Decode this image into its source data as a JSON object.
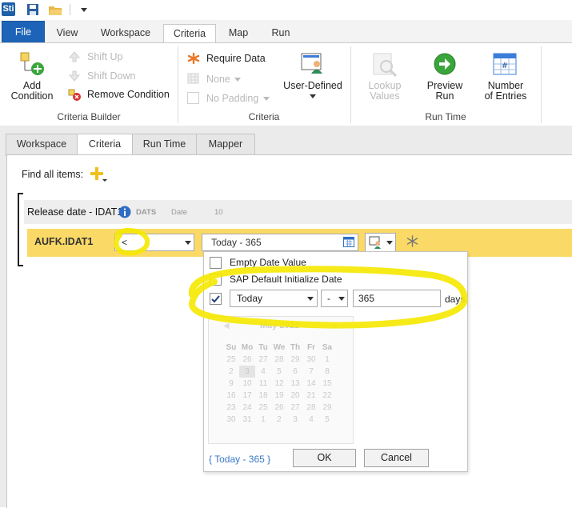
{
  "qat": {
    "logo": "Sti"
  },
  "ribbon_tabs": [
    {
      "label": "File"
    },
    {
      "label": "View"
    },
    {
      "label": "Workspace"
    },
    {
      "label": "Criteria"
    },
    {
      "label": "Map"
    },
    {
      "label": "Run"
    }
  ],
  "criteria_builder": {
    "add_condition": "Add\nCondition",
    "shift_up": "Shift Up",
    "shift_down": "Shift Down",
    "remove_condition": "Remove Condition",
    "group_label": "Criteria Builder"
  },
  "criteria_group": {
    "require_data": "Require Data",
    "none": "None",
    "no_padding": "No Padding",
    "user_defined": "User-Defined",
    "group_label": "Criteria"
  },
  "run_time_group": {
    "lookup_values": "Lookup\nValues",
    "preview_run": "Preview\nRun",
    "number_of_entries": "Number\nof Entries",
    "group_label": "Run Time"
  },
  "panel_tabs": [
    {
      "label": "Workspace"
    },
    {
      "label": "Criteria"
    },
    {
      "label": "Run Time"
    },
    {
      "label": "Mapper"
    }
  ],
  "find_all_items": "Find all items:",
  "field": {
    "title": "Release date - IDAT1",
    "type": "DATS",
    "kind": "Date",
    "length": "10",
    "name": "AUFK.IDAT1",
    "operator": "<",
    "value": "Today - 365"
  },
  "popup": {
    "empty_date_value": "Empty Date Value",
    "sap_default": "SAP Default Initialize Date",
    "today_option": "Today",
    "sign_option": "-",
    "days_value": "365",
    "days_label": "days",
    "month_label": "May 2021",
    "weekdays": [
      "Su",
      "Mo",
      "Tu",
      "We",
      "Th",
      "Fr",
      "Sa"
    ],
    "weeks": [
      [
        "25",
        "26",
        "27",
        "28",
        "29",
        "30",
        "1"
      ],
      [
        "2",
        "3",
        "4",
        "5",
        "6",
        "7",
        "8"
      ],
      [
        "9",
        "10",
        "11",
        "12",
        "13",
        "14",
        "15"
      ],
      [
        "16",
        "17",
        "18",
        "19",
        "20",
        "21",
        "22"
      ],
      [
        "23",
        "24",
        "25",
        "26",
        "27",
        "28",
        "29"
      ],
      [
        "30",
        "31",
        "1",
        "2",
        "3",
        "4",
        "5"
      ]
    ],
    "summary": "{ Today - 365 }",
    "ok": "OK",
    "cancel": "Cancel"
  },
  "colors": {
    "accent": "#1d63b7",
    "highlight": "#fad966",
    "annotation": "#f5e800"
  }
}
